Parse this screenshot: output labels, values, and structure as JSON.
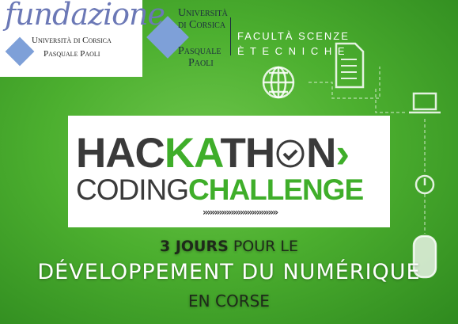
{
  "fondazione": {
    "script": "fundazione",
    "line1": "Università di Corsica",
    "line2": "Pasquale Paoli"
  },
  "universita": {
    "line1": "Università",
    "line2": "di Corsica",
    "line3": "Pasquale",
    "line4": "Paoli"
  },
  "facolta": {
    "line1": "FACULTÀ SCENZE",
    "line2": "È  T E C N I C H E"
  },
  "banner": {
    "hack_1": "HAC",
    "hack_k": "K",
    "hack_a": "A",
    "hack_2": "TH",
    "hack_3": "N",
    "hack_chevron": "›",
    "coding": "CODING",
    "challenge": "CHALLENGE",
    "arrows": "››››››››››››››››››››››››››››››››"
  },
  "tagline": {
    "days": "3 JOURS",
    "pour": " POUR LE",
    "main": "DÉVELOPPEMENT DU NUMÉRIQUE",
    "region": "EN CORSE"
  },
  "colors": {
    "green": "#4caf2f",
    "accent": "#3fae2a",
    "dark": "#3a3a3a"
  }
}
